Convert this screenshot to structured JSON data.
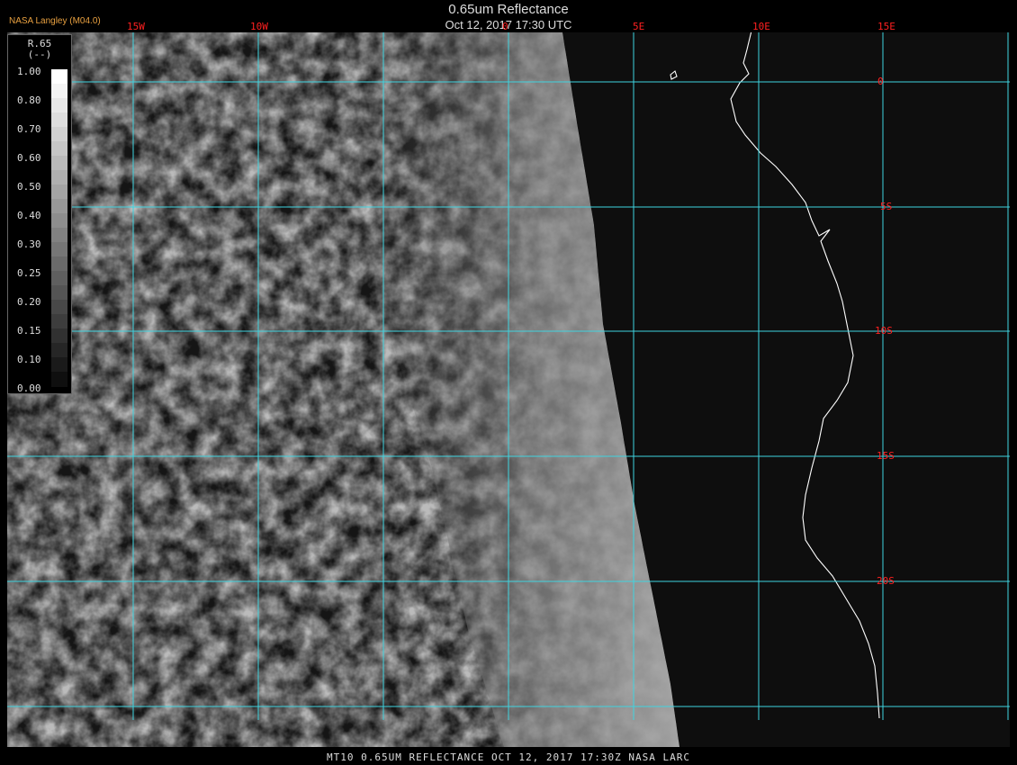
{
  "header": {
    "title": "0.65um Reflectance",
    "subtitle": "Oct 12, 2017 17:30 UTC",
    "credit": "NASA Langley (M04.0)"
  },
  "grid": {
    "lon_labels": [
      "15W",
      "10W",
      "0",
      "5E",
      "10E",
      "15E"
    ],
    "lat_labels": [
      "0",
      "5S",
      "10S",
      "15S",
      "20S"
    ]
  },
  "legend": {
    "title": "R.65",
    "units": "(--)",
    "ticks": [
      "1.00",
      "0.80",
      "0.70",
      "0.60",
      "0.50",
      "0.40",
      "0.30",
      "0.25",
      "0.20",
      "0.15",
      "0.10",
      "0.00"
    ]
  },
  "colors": {
    "gridline": "#3fd4e0",
    "label": "#ff2020",
    "coast": "#ffffff",
    "credit": "#e8a040"
  },
  "footer": {
    "text": "MT10  0.65UM REFLECTANCE   OCT 12, 2017 17:30Z   NASA LARC"
  }
}
